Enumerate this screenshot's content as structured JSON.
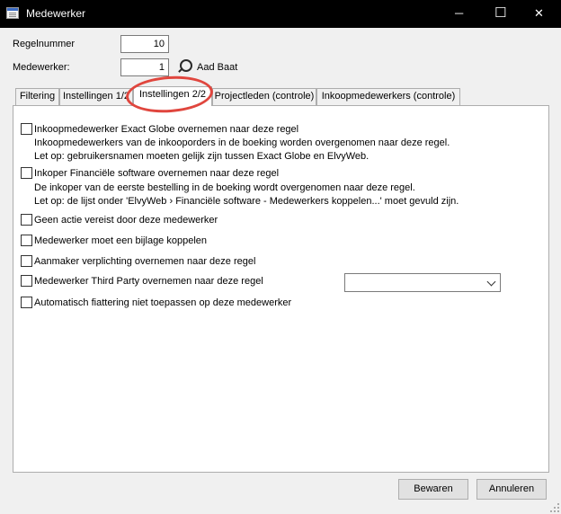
{
  "window": {
    "title": "Medewerker",
    "minimize_glyph": "─",
    "maximize_glyph": "☐",
    "close_glyph": "✕"
  },
  "header": {
    "regelnummer_label": "Regelnummer",
    "regelnummer_value": "10",
    "medewerker_label": "Medewerker:",
    "medewerker_value": "1",
    "medewerker_name": "Aad Baat",
    "lookup_icon": "magnifier-icon"
  },
  "tabs": [
    {
      "label": "Filtering",
      "active": false
    },
    {
      "label": "Instellingen 1/2",
      "active": false
    },
    {
      "label": "Instellingen 2/2",
      "active": true
    },
    {
      "label": "Projectleden (controle)",
      "active": false
    },
    {
      "label": "Inkoopmedewerkers (controle)",
      "active": false
    }
  ],
  "options": [
    {
      "label": "Inkoopmedewerker Exact Globe overnemen naar deze regel",
      "checked": false,
      "desc": [
        "Inkoopmedewerkers van de inkooporders in de boeking worden overgenomen naar deze regel.",
        "Let op: gebruikersnamen moeten gelijk zijn tussen Exact Globe en ElvyWeb."
      ]
    },
    {
      "label": "Inkoper Financiële software overnemen naar deze regel",
      "checked": false,
      "desc": [
        "De inkoper van de eerste bestelling in de boeking wordt overgenomen naar deze regel.",
        "Let op: de lijst onder 'ElvyWeb › Financiële software - Medewerkers koppelen...' moet gevuld zijn."
      ]
    },
    {
      "label": "Geen actie vereist door deze medewerker",
      "checked": false
    },
    {
      "label": "Medewerker moet een bijlage koppelen",
      "checked": false
    },
    {
      "label": "Aanmaker verplichting overnemen naar deze regel",
      "checked": false
    },
    {
      "label": "Medewerker Third Party overnemen naar deze regel",
      "checked": false,
      "select_value": ""
    },
    {
      "label": "Automatisch fiattering niet toepassen op deze medewerker",
      "checked": false
    }
  ],
  "footer": {
    "save_label": "Bewaren",
    "cancel_label": "Annuleren"
  },
  "colors": {
    "highlight": "#e0463e",
    "titlebar": "#000000"
  }
}
